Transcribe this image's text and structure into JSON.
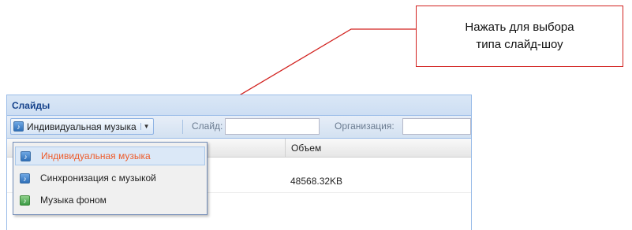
{
  "callout": {
    "line1": "Нажать для выбора",
    "line2": "типа слайд-шоу"
  },
  "panel": {
    "title": "Слайды"
  },
  "toolbar": {
    "music_type_button": "Индивидуальная музыка",
    "slide_label": "Слайд:",
    "organization_label": "Организация:",
    "slide_value": "",
    "organization_value": ""
  },
  "grid": {
    "columns": [
      "Объем"
    ],
    "rows": [
      {
        "size": "48568.32KB"
      }
    ]
  },
  "menu": {
    "items": [
      {
        "label": "Индивидуальная музыка",
        "selected": true
      },
      {
        "label": "Синхронизация с музыкой",
        "selected": false
      },
      {
        "label": "Музыка фоном",
        "selected": false
      }
    ]
  },
  "colors": {
    "callout_border": "#d2221f",
    "accent": "#ee5b2a",
    "panel_border": "#99bbe8"
  }
}
